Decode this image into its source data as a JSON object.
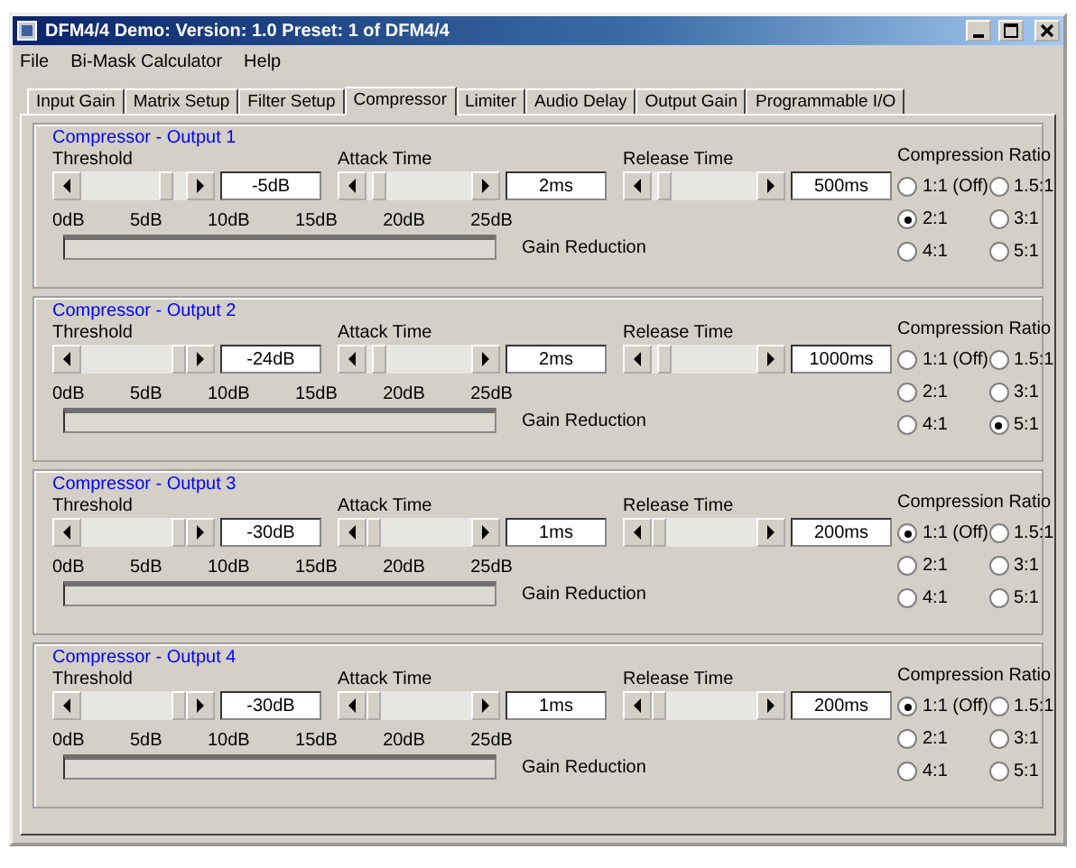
{
  "window": {
    "title": "DFM4/4 Demo: Version: 1.0 Preset: 1 of DFM4/4"
  },
  "menu": [
    {
      "label": "File"
    },
    {
      "label": "Bi-Mask Calculator"
    },
    {
      "label": "Help"
    }
  ],
  "tabs": [
    {
      "label": "Input Gain",
      "selected": false
    },
    {
      "label": "Matrix Setup",
      "selected": false
    },
    {
      "label": "Filter Setup",
      "selected": false
    },
    {
      "label": "Compressor",
      "selected": true
    },
    {
      "label": "Limiter",
      "selected": false
    },
    {
      "label": "Audio Delay",
      "selected": false
    },
    {
      "label": "Output Gain",
      "selected": false
    },
    {
      "label": "Programmable I/O",
      "selected": false
    }
  ],
  "groups": [
    {
      "title": "Compressor - Output 1",
      "threshold": {
        "label": "Threshold",
        "value": "-5dB",
        "level": 0.85
      },
      "attack": {
        "label": "Attack Time",
        "value": "2ms",
        "level": 0.05
      },
      "release": {
        "label": "Release Time",
        "value": "500ms",
        "level": 0.05
      },
      "scale": [
        "0dB",
        "5dB",
        "10dB",
        "15dB",
        "20dB",
        "25dB"
      ],
      "meter_label": "Gain Reduction",
      "ratio": {
        "label": "Compression Ratio",
        "options": [
          {
            "label": "1:1 (Off)",
            "selected": false
          },
          {
            "label": "1.5:1",
            "selected": false
          },
          {
            "label": "2:1",
            "selected": true
          },
          {
            "label": "3:1",
            "selected": false
          },
          {
            "label": "4:1",
            "selected": false
          },
          {
            "label": "5:1",
            "selected": false
          }
        ]
      }
    },
    {
      "title": "Compressor - Output 2",
      "threshold": {
        "label": "Threshold",
        "value": "-24dB",
        "level": 1
      },
      "attack": {
        "label": "Attack Time",
        "value": "2ms",
        "level": 0.05
      },
      "release": {
        "label": "Release Time",
        "value": "1000ms",
        "level": 0.05
      },
      "scale": [
        "0dB",
        "5dB",
        "10dB",
        "15dB",
        "20dB",
        "25dB"
      ],
      "meter_label": "Gain Reduction",
      "ratio": {
        "label": "Compression Ratio",
        "options": [
          {
            "label": "1:1 (Off)",
            "selected": false
          },
          {
            "label": "1.5:1",
            "selected": false
          },
          {
            "label": "2:1",
            "selected": false
          },
          {
            "label": "3:1",
            "selected": false
          },
          {
            "label": "4:1",
            "selected": false
          },
          {
            "label": "5:1",
            "selected": true
          }
        ]
      }
    },
    {
      "title": "Compressor - Output 3",
      "threshold": {
        "label": "Threshold",
        "value": "-30dB",
        "level": 1
      },
      "attack": {
        "label": "Attack Time",
        "value": "1ms",
        "level": 0
      },
      "release": {
        "label": "Release Time",
        "value": "200ms",
        "level": 0
      },
      "scale": [
        "0dB",
        "5dB",
        "10dB",
        "15dB",
        "20dB",
        "25dB"
      ],
      "meter_label": "Gain Reduction",
      "ratio": {
        "label": "Compression Ratio",
        "options": [
          {
            "label": "1:1 (Off)",
            "selected": true
          },
          {
            "label": "1.5:1",
            "selected": false
          },
          {
            "label": "2:1",
            "selected": false
          },
          {
            "label": "3:1",
            "selected": false
          },
          {
            "label": "4:1",
            "selected": false
          },
          {
            "label": "5:1",
            "selected": false
          }
        ]
      }
    },
    {
      "title": "Compressor - Output 4",
      "threshold": {
        "label": "Threshold",
        "value": "-30dB",
        "level": 1
      },
      "attack": {
        "label": "Attack Time",
        "value": "1ms",
        "level": 0
      },
      "release": {
        "label": "Release Time",
        "value": "200ms",
        "level": 0
      },
      "scale": [
        "0dB",
        "5dB",
        "10dB",
        "15dB",
        "20dB",
        "25dB"
      ],
      "meter_label": "Gain Reduction",
      "ratio": {
        "label": "Compression Ratio",
        "options": [
          {
            "label": "1:1 (Off)",
            "selected": true
          },
          {
            "label": "1.5:1",
            "selected": false
          },
          {
            "label": "2:1",
            "selected": false
          },
          {
            "label": "3:1",
            "selected": false
          },
          {
            "label": "4:1",
            "selected": false
          },
          {
            "label": "5:1",
            "selected": false
          }
        ]
      }
    }
  ]
}
